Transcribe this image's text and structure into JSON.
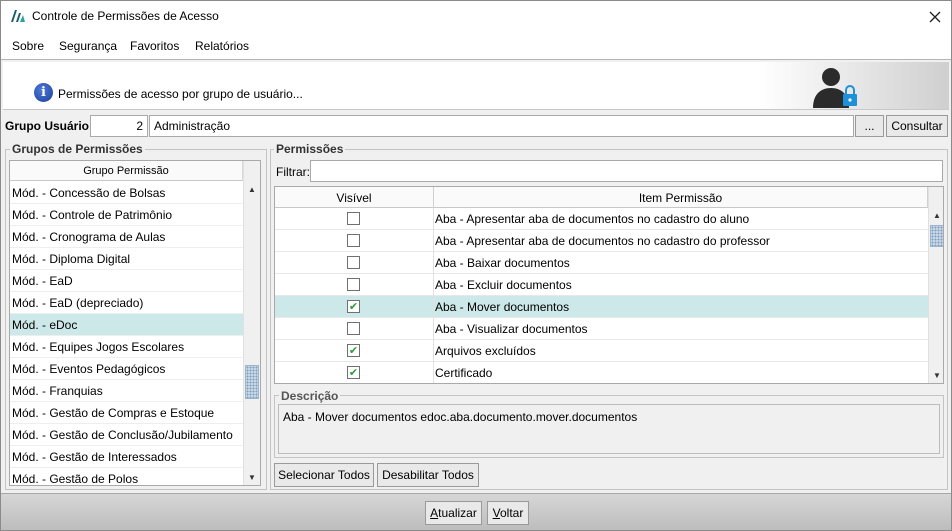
{
  "window": {
    "title": "Controle de Permissões de Acesso",
    "close_glyph": "✕"
  },
  "menu": {
    "items": [
      "Sobre",
      "Segurança",
      "Favoritos",
      "Relatórios"
    ]
  },
  "banner": {
    "info_glyph": "i",
    "text": "Permissões de acesso por grupo de usuário..."
  },
  "grupo_usuario": {
    "label": "Grupo Usuário:",
    "code": "2",
    "name": "Administração",
    "dots_label": "...",
    "consultar_label": "Consultar"
  },
  "grupos_permissoes": {
    "title": "Grupos de Permissões",
    "column_header": "Grupo Permissão",
    "items": [
      "Mód. - Concessão de Bolsas",
      "Mód. - Controle de Patrimônio",
      "Mód. - Cronograma de Aulas",
      "Mód. - Diploma Digital",
      "Mód. - EaD",
      "Mód. - EaD (depreciado)",
      "Mód. - eDoc",
      "Mód. - Equipes Jogos Escolares",
      "Mód. - Eventos Pedagógicos",
      "Mód. - Franquias",
      "Mód. - Gestão de Compras e Estoque",
      "Mód. - Gestão de Conclusão/Jubilamento",
      "Mód. - Gestão de Interessados",
      "Mód. - Gestão de Polos"
    ],
    "selected": "Mód. - eDoc"
  },
  "permissoes": {
    "title": "Permissões",
    "filter_label": "Filtrar:",
    "filter_value": "",
    "columns": [
      "Visível",
      "Item Permissão"
    ],
    "rows": [
      {
        "checked": false,
        "item": "Aba - Apresentar aba de documentos no cadastro do aluno"
      },
      {
        "checked": false,
        "item": "Aba - Apresentar aba de documentos no cadastro do professor"
      },
      {
        "checked": false,
        "item": "Aba - Baixar documentos"
      },
      {
        "checked": false,
        "item": "Aba - Excluir documentos"
      },
      {
        "checked": true,
        "item": "Aba - Mover documentos",
        "selected": true
      },
      {
        "checked": false,
        "item": "Aba - Visualizar documentos"
      },
      {
        "checked": true,
        "item": "Arquivos excluídos"
      },
      {
        "checked": true,
        "item": "Certificado"
      }
    ],
    "check_glyph": "✔"
  },
  "descricao": {
    "title": "Descrição",
    "text": "Aba - Mover documentos edoc.aba.documento.mover.documentos"
  },
  "actions": {
    "selecionar_todos": "Selecionar Todos",
    "desabilitar_todos": "Desabilitar Todos"
  },
  "bottom": {
    "atualizar": "Atualizar",
    "voltar": "Voltar"
  },
  "colors": {
    "selection": "#cde8e8",
    "check": "#2e9a3a",
    "info_icon": "#1b3f9c",
    "lock": "#1e90d8"
  }
}
